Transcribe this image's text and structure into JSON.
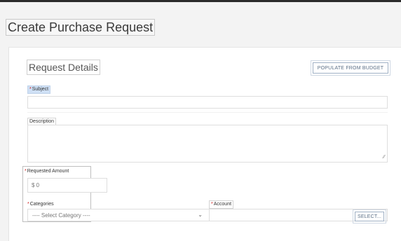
{
  "page": {
    "title": "Create Purchase Request"
  },
  "section": {
    "title": "Request Details"
  },
  "buttons": {
    "populate": "POPULATE FROM BUDGET",
    "select": "SELECT..."
  },
  "fields": {
    "subject": {
      "required_marker": "*",
      "label": "Subject",
      "value": ""
    },
    "description": {
      "label": "Description",
      "value": ""
    },
    "requested_amount": {
      "required_marker": "*",
      "label": "Requested Amount",
      "value": "$ 0"
    },
    "categories": {
      "required_marker": "*",
      "label": "Categories",
      "selected": "---- Select Category ----"
    },
    "account": {
      "required_marker": "*",
      "label": "Account",
      "value": ""
    }
  },
  "icons": {
    "dropdown": "chevron-down-icon",
    "resize": "resize-grip-icon"
  },
  "colors": {
    "required": "#d11a1a",
    "highlight": "#cfe0f5",
    "button_text": "#5b6f86"
  }
}
